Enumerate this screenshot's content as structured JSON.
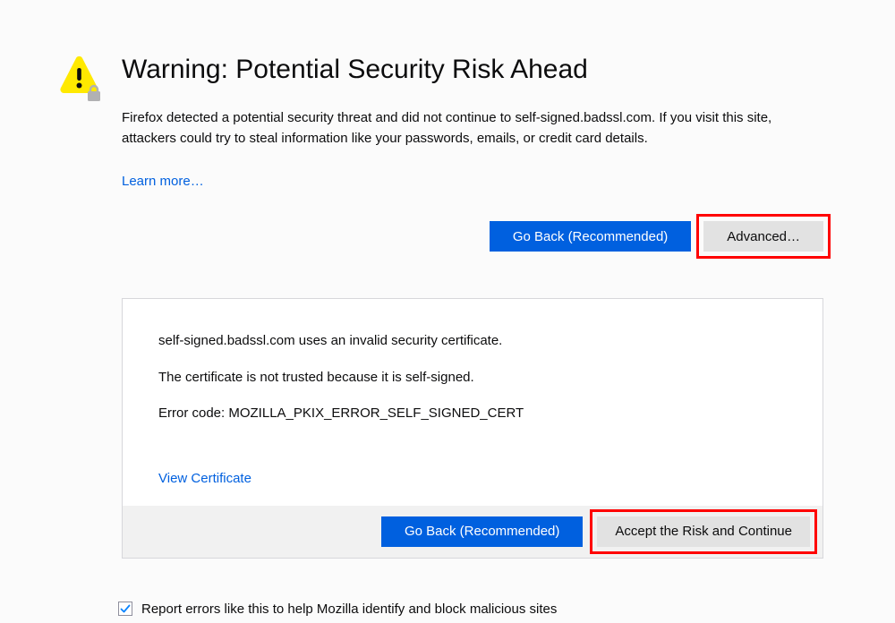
{
  "title": "Warning: Potential Security Risk Ahead",
  "description": "Firefox detected a potential security threat and did not continue to self-signed.badssl.com. If you visit this site, attackers could try to steal information like your passwords, emails, or credit card details.",
  "learn_more": "Learn more…",
  "go_back": "Go Back (Recommended)",
  "advanced": "Advanced…",
  "panel": {
    "line1": "self-signed.badssl.com uses an invalid security certificate.",
    "line2": "The certificate is not trusted because it is self-signed.",
    "error_code": "Error code: MOZILLA_PKIX_ERROR_SELF_SIGNED_CERT",
    "view_certificate": "View Certificate",
    "go_back": "Go Back (Recommended)",
    "accept": "Accept the Risk and Continue"
  },
  "report_label": "Report errors like this to help Mozilla identify and block malicious sites"
}
